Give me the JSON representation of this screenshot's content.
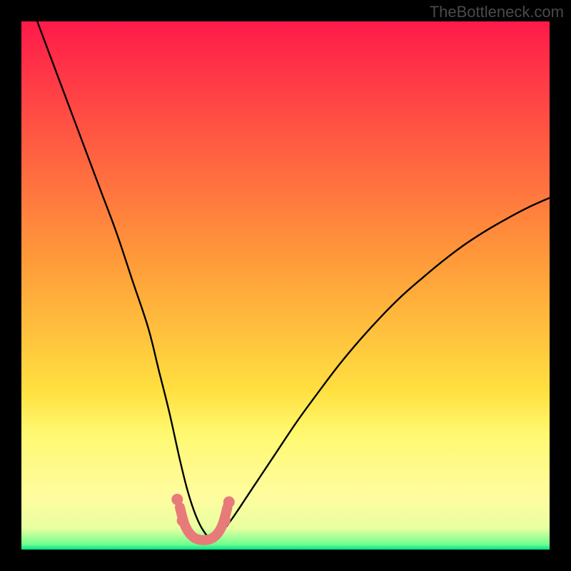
{
  "watermark": "TheBottleneck.com",
  "chart_data": {
    "type": "line",
    "title": "",
    "xlabel": "",
    "ylabel": "",
    "xlim": [
      0,
      100
    ],
    "ylim": [
      0,
      100
    ],
    "background_gradient": {
      "stops": [
        {
          "offset": 0.0,
          "color": "#ff1a4a"
        },
        {
          "offset": 0.45,
          "color": "#ff9a3a"
        },
        {
          "offset": 0.7,
          "color": "#ffe040"
        },
        {
          "offset": 0.78,
          "color": "#fff970"
        },
        {
          "offset": 0.9,
          "color": "#fffca0"
        },
        {
          "offset": 0.96,
          "color": "#e8ffa0"
        },
        {
          "offset": 0.99,
          "color": "#70ff90"
        },
        {
          "offset": 1.0,
          "color": "#00e088"
        }
      ]
    },
    "series": [
      {
        "name": "main-curve",
        "color": "#000000",
        "x": [
          3,
          6,
          9,
          12,
          15,
          18,
          21,
          24,
          26,
          28,
          30,
          31.5,
          33,
          34.5,
          36,
          38,
          40,
          44,
          48,
          52,
          56,
          60,
          64,
          68,
          72,
          76,
          80,
          84,
          88,
          92,
          96,
          100
        ],
        "y": [
          100,
          92,
          84,
          76,
          68,
          60,
          51,
          42,
          34,
          26,
          17,
          11,
          6.5,
          3.5,
          2.2,
          3.5,
          6,
          12,
          18,
          24,
          29.5,
          34.8,
          39.6,
          44,
          48,
          51.5,
          54.8,
          57.8,
          60.4,
          62.7,
          64.8,
          66.6
        ]
      },
      {
        "name": "marker-line",
        "color": "#e87a7a",
        "stroke_width": 14,
        "linecap": "round",
        "x": [
          30,
          31,
          32.5,
          34.5,
          36.5,
          38,
          39
        ],
        "y": [
          8,
          4.5,
          2.4,
          1.8,
          2.4,
          4.5,
          8
        ]
      }
    ],
    "markers": [
      {
        "name": "dot-left-upper",
        "x": 29.5,
        "y": 9.5,
        "r": 8,
        "color": "#e87a7a"
      },
      {
        "name": "dot-left-lower",
        "x": 30.5,
        "y": 5.5,
        "r": 8,
        "color": "#e87a7a"
      },
      {
        "name": "dot-right-lower",
        "x": 38.5,
        "y": 5.5,
        "r": 8,
        "color": "#e87a7a"
      },
      {
        "name": "dot-right-upper",
        "x": 39.3,
        "y": 9.0,
        "r": 8,
        "color": "#e87a7a"
      }
    ]
  }
}
